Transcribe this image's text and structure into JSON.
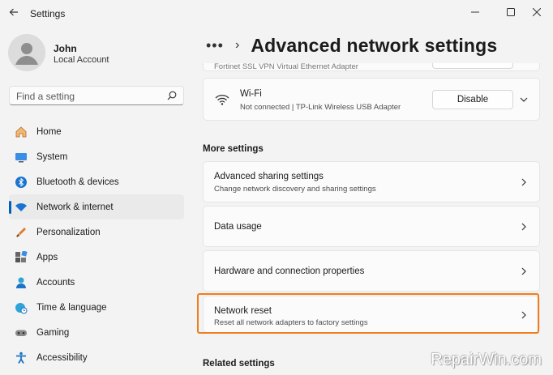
{
  "app": {
    "title": "Settings"
  },
  "profile": {
    "name": "John",
    "account_type": "Local Account"
  },
  "search": {
    "placeholder": "Find a setting"
  },
  "nav": {
    "items": [
      {
        "label": "Home",
        "icon": "home-icon"
      },
      {
        "label": "System",
        "icon": "system-icon"
      },
      {
        "label": "Bluetooth & devices",
        "icon": "bluetooth-icon"
      },
      {
        "label": "Network & internet",
        "icon": "wifi-icon",
        "selected": true
      },
      {
        "label": "Personalization",
        "icon": "brush-icon"
      },
      {
        "label": "Apps",
        "icon": "apps-icon"
      },
      {
        "label": "Accounts",
        "icon": "accounts-icon"
      },
      {
        "label": "Time & language",
        "icon": "globe-clock-icon"
      },
      {
        "label": "Gaming",
        "icon": "gamepad-icon"
      },
      {
        "label": "Accessibility",
        "icon": "accessibility-icon"
      }
    ]
  },
  "header": {
    "breadcrumb_more": "•••",
    "separator": "›",
    "title": "Advanced network settings"
  },
  "adapters": {
    "partial_label": "Fortinet SSL VPN Virtual Ethernet Adapter",
    "wifi": {
      "title": "Wi-Fi",
      "subtitle": "Not connected | TP-Link Wireless USB Adapter",
      "button": "Disable"
    }
  },
  "more_settings": {
    "label": "More settings",
    "items": [
      {
        "title": "Advanced sharing settings",
        "subtitle": "Change network discovery and sharing settings"
      },
      {
        "title": "Data usage",
        "subtitle": ""
      },
      {
        "title": "Hardware and connection properties",
        "subtitle": ""
      },
      {
        "title": "Network reset",
        "subtitle": "Reset all network adapters to factory settings"
      }
    ]
  },
  "related_settings": {
    "label": "Related settings"
  },
  "watermark": "RepairWin.com",
  "colors": {
    "accent": "#005fb8",
    "highlight": "#f07d1e",
    "background": "#f3f3f3",
    "card": "#fbfbfb"
  }
}
